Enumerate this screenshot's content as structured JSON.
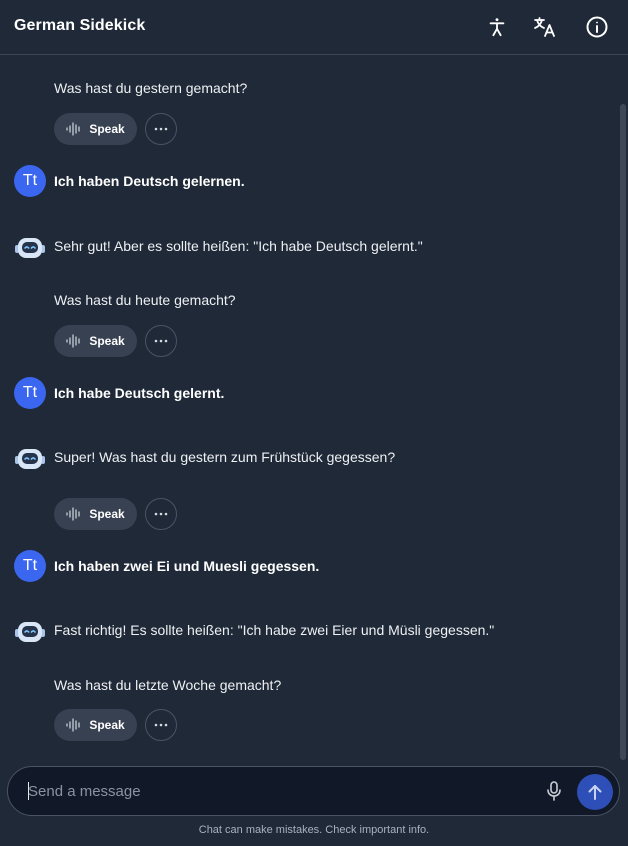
{
  "header": {
    "title": "German Sidekick",
    "icons": [
      "accessibility-icon",
      "translate-icon",
      "info-icon"
    ]
  },
  "user_avatar_initials": "Tt",
  "speak_label": "Speak",
  "messages": [
    {
      "role": "assistant",
      "text": "Was hast du gestern gemacht?"
    },
    {
      "role": "user",
      "text": "Ich haben Deutsch gelernen."
    },
    {
      "role": "assistant",
      "text": "Sehr gut! Aber es sollte heißen: \"Ich habe Deutsch gelernt.\"",
      "question": "Was hast du heute gemacht?"
    },
    {
      "role": "user",
      "text": "Ich habe Deutsch gelernt."
    },
    {
      "role": "assistant",
      "text": "Super! Was hast du gestern zum Frühstück gegessen?"
    },
    {
      "role": "user",
      "text": "Ich haben zwei Ei und Muesli gegessen."
    },
    {
      "role": "assistant",
      "text": "Fast richtig! Es sollte heißen: \"Ich habe zwei Eier und Müsli gegessen.\"",
      "question": "Was hast du letzte Woche gemacht?"
    }
  ],
  "composer": {
    "placeholder": "Send a message",
    "value": ""
  },
  "disclaimer": "Chat can make mistakes. Check important info.",
  "colors": {
    "background": "#1f2937",
    "user_avatar": "#3b66f0",
    "speak_button": "#374151",
    "send_button": "#2e4fb7",
    "input_background": "#111827"
  }
}
